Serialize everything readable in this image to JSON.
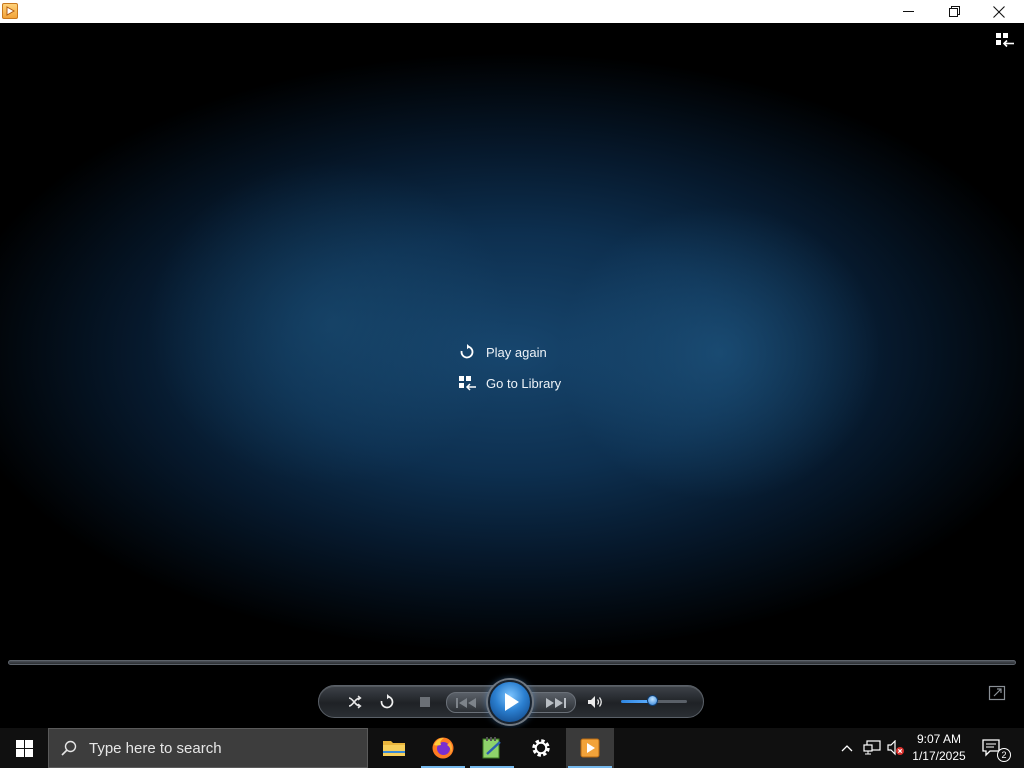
{
  "window": {
    "icon": "wmp-app-icon",
    "controls": [
      "minimize-icon",
      "restore-icon",
      "close-icon"
    ]
  },
  "now_playing": {
    "switch_to_library_icon": "switch-to-library-icon",
    "end_menu": [
      {
        "label": "Play again",
        "icon": "replay-icon"
      },
      {
        "label": "Go to Library",
        "icon": "library-icon"
      }
    ]
  },
  "controls": {
    "buttons": [
      "shuffle-icon",
      "repeat-icon",
      "stop-icon",
      "previous-icon",
      "play-icon",
      "next-icon",
      "volume-icon"
    ],
    "volume_level": 0.48,
    "seek_position": 0
  },
  "taskbar": {
    "search_placeholder": "Type here to search",
    "apps": [
      "file-explorer-icon",
      "firefox-icon",
      "notepad-plus-icon",
      "settings-icon",
      "windows-media-player-icon"
    ],
    "tray_icons": [
      "chevron-up-icon",
      "network-icon",
      "volume-muted-icon"
    ],
    "time": "9:07 AM",
    "date": "1/17/2025",
    "notification_count": "2",
    "colors": {
      "taskbar": "#101010",
      "accent": "#76b9ed"
    }
  }
}
